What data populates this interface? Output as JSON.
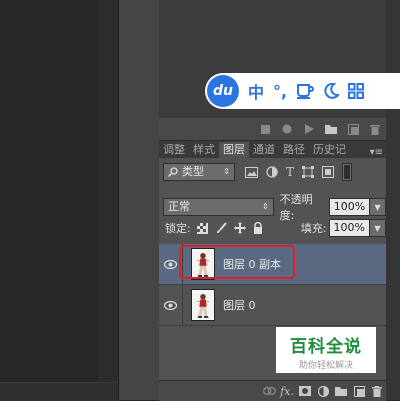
{
  "ime_toolbar": {
    "logo": "du",
    "mode": "中",
    "punct": "°,",
    "items": [
      "cup-icon",
      "moon-icon",
      "grid-icon"
    ]
  },
  "panel": {
    "tabs": [
      {
        "label": "调整",
        "active": false
      },
      {
        "label": "样式",
        "active": false
      },
      {
        "label": "图层",
        "active": true
      },
      {
        "label": "通道",
        "active": false
      },
      {
        "label": "路径",
        "active": false
      },
      {
        "label": "历史记",
        "active": false
      }
    ],
    "filter": {
      "kind_label": "类型"
    },
    "blend": {
      "mode": "正常",
      "opacity_label": "不透明度:",
      "opacity_value": "100%"
    },
    "lock": {
      "label": "锁定:",
      "fill_label": "填充:",
      "fill_value": "100%"
    },
    "layers": [
      {
        "name": "图层 0 副本",
        "selected": true,
        "visible": true
      },
      {
        "name": "图层 0",
        "selected": false,
        "visible": true
      }
    ],
    "bottom_icons": [
      "link-icon",
      "fx-icon",
      "mask-icon",
      "adjustment-icon",
      "group-folder-icon",
      "new-layer-icon",
      "delete-icon"
    ],
    "fx_label": "fx."
  },
  "watermark": {
    "title": "百科全说",
    "subtitle": "助你轻松解决"
  },
  "colors": {
    "selected_layer": "#5b6a82",
    "highlight_box": "#d8232a",
    "ime_blue": "#2b74e2",
    "watermark_green": "#1e8e3e"
  }
}
